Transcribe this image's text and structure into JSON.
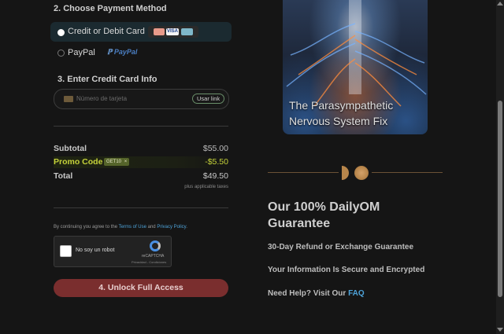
{
  "payment": {
    "section_title": "2. Choose Payment Method",
    "card_option_label": "Credit or Debit Card",
    "card_brand_visa": "VISA",
    "paypal_option_label": "PayPal",
    "paypal_logo_text": "PayPal"
  },
  "card_info": {
    "section_title": "3. Enter Credit Card Info",
    "card_number_placeholder": "Número de tarjeta",
    "link_button_label": "Usar link"
  },
  "summary": {
    "subtotal_label": "Subtotal",
    "subtotal_value": "$55.00",
    "promo_label": "Promo Code",
    "promo_code": "GET10",
    "promo_remove": "×",
    "promo_value": "-$5.50",
    "total_label": "Total",
    "total_value": "$49.50",
    "tax_note": "plus applicable taxes"
  },
  "terms": {
    "prefix": "By continuing you agree to the ",
    "terms_link": "Terms of Use",
    "and": " and ",
    "privacy_link": "Privacy Policy",
    "suffix": "."
  },
  "captcha": {
    "checkbox_label": "No soy un robot",
    "brand": "reCAPTCHA",
    "footer": "Privacidad - Condiciones"
  },
  "cta": {
    "unlock_label": "4. Unlock Full Access"
  },
  "course": {
    "title_line1": "The Parasympathetic",
    "title_line2": "Nervous System Fix"
  },
  "guarantee": {
    "title_line1": "Our 100% DailyOM",
    "title_line2": "Guarantee",
    "refund": "30-Day Refund or Exchange Guarantee",
    "secure": "Your Information Is Secure and Encrypted",
    "help_prefix": "Need Help? Visit Our ",
    "help_link": "FAQ"
  },
  "colors": {
    "background": "#151515",
    "link_blue": "#4ea3d9",
    "promo_green": "#c6d33a",
    "cta_red": "#7a2e2e",
    "gold": "#b8864b"
  }
}
